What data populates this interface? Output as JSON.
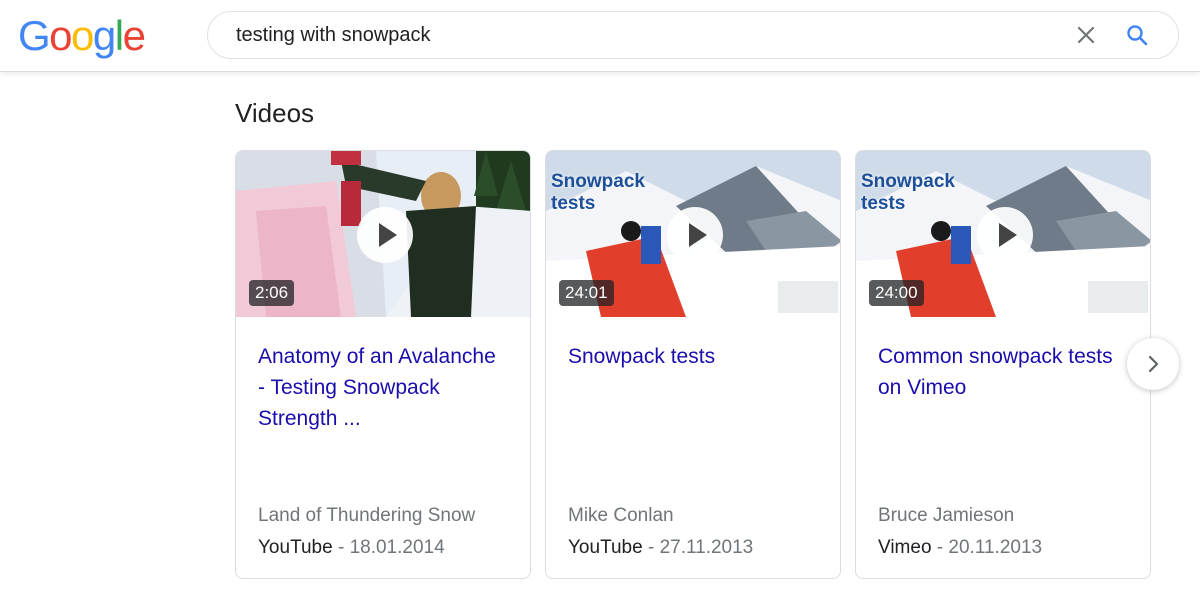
{
  "header": {
    "logo": [
      "G",
      "o",
      "o",
      "g",
      "l",
      "e"
    ],
    "logo_colors": [
      "#4285F4",
      "#EA4335",
      "#FBBC05",
      "#4285F4",
      "#34A853",
      "#EA4335"
    ],
    "search_query": "testing with snowpack"
  },
  "section": {
    "title": "Videos"
  },
  "videos": [
    {
      "duration": "2:06",
      "overlay_text": "",
      "title": "Anatomy of an Avalanche - Testing Snowpack Strength ...",
      "author": "Land of Thundering Snow",
      "platform": "YouTube",
      "date": "18.01.2014"
    },
    {
      "duration": "24:01",
      "overlay_text": "Snowpack tests",
      "title": "Snowpack tests",
      "author": "Mike Conlan",
      "platform": "YouTube",
      "date": "27.11.2013"
    },
    {
      "duration": "24:00",
      "overlay_text": "Snowpack tests",
      "title": "Common snowpack tests on Vimeo",
      "author": "Bruce Jamieson",
      "platform": "Vimeo",
      "date": "20.11.2013"
    }
  ],
  "colors": {
    "link": "#1a0dab",
    "muted": "#70757a",
    "search_icon": "#4285F4"
  }
}
